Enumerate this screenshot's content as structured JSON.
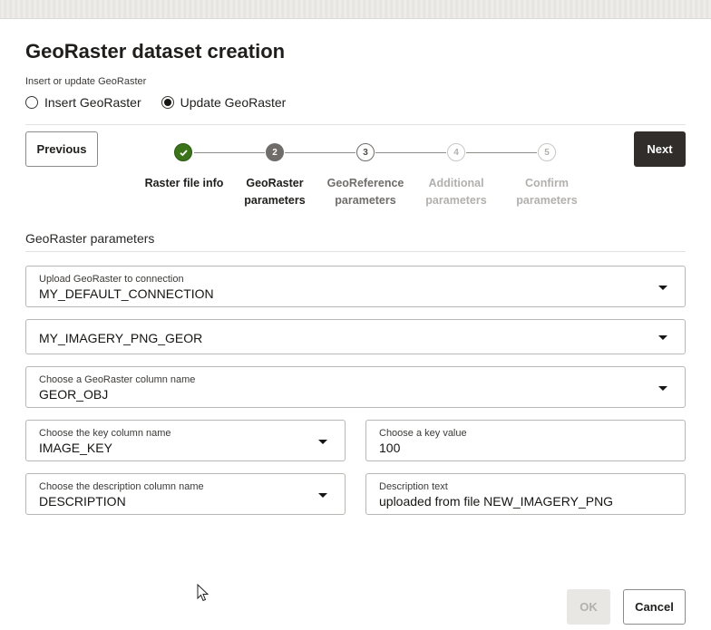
{
  "dialog": {
    "title": "GeoRaster dataset creation",
    "mode_label": "Insert or update GeoRaster",
    "modes": [
      {
        "label": "Insert GeoRaster",
        "selected": false
      },
      {
        "label": "Update GeoRaster",
        "selected": true
      }
    ]
  },
  "nav": {
    "previous_label": "Previous",
    "next_label": "Next"
  },
  "steps": [
    {
      "number": "✓",
      "line1": "Raster file info",
      "line2": "",
      "state": "done"
    },
    {
      "number": "2",
      "line1": "GeoRaster",
      "line2": "parameters",
      "state": "current"
    },
    {
      "number": "3",
      "line1": "GeoReference",
      "line2": "parameters",
      "state": "next"
    },
    {
      "number": "4",
      "line1": "Additional",
      "line2": "parameters",
      "state": "future"
    },
    {
      "number": "5",
      "line1": "Confirm",
      "line2": "parameters",
      "state": "future"
    }
  ],
  "section": {
    "title": "GeoRaster parameters"
  },
  "fields": {
    "connection": {
      "label": "Upload GeoRaster to connection",
      "value": "MY_DEFAULT_CONNECTION"
    },
    "table": {
      "label": "",
      "value": "MY_IMAGERY_PNG_GEOR"
    },
    "column": {
      "label": "Choose a GeoRaster column name",
      "value": "GEOR_OBJ"
    },
    "key_column": {
      "label": "Choose the key column name",
      "value": "IMAGE_KEY"
    },
    "key_value": {
      "label": "Choose a key value",
      "value": "100"
    },
    "desc_column": {
      "label": "Choose the description column name",
      "value": "DESCRIPTION"
    },
    "desc_text": {
      "label": "Description text",
      "value": "uploaded from file NEW_IMAGERY_PNG"
    }
  },
  "footer": {
    "ok_label": "OK",
    "cancel_label": "Cancel"
  },
  "colors": {
    "done_step": "#3a7319",
    "primary_button": "#312d2a"
  }
}
